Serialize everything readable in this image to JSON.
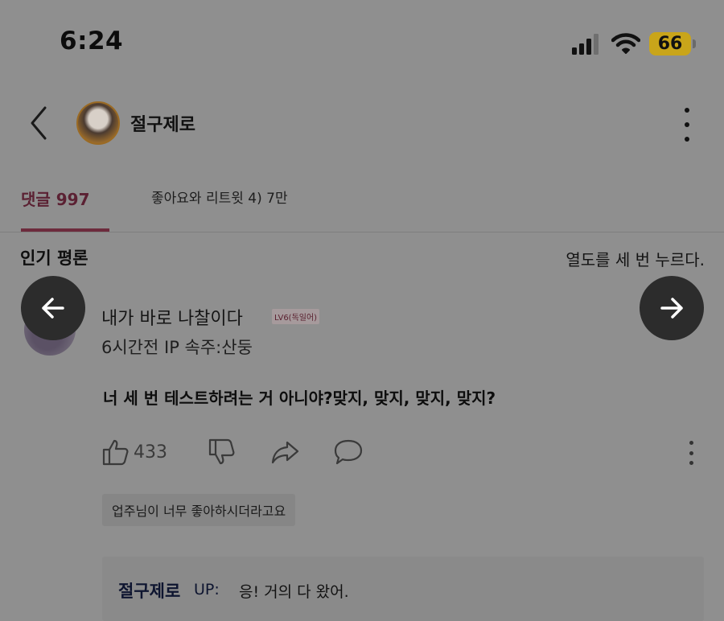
{
  "status_bar": {
    "time": "6:24",
    "battery": "66",
    "icons": [
      "cellular-signal-icon",
      "wifi-icon",
      "battery-icon"
    ],
    "battery_color": "#c9a51a"
  },
  "header": {
    "username": "절구제로",
    "back_icon": "chevron-left-icon",
    "menu_icon": "more-vertical-icon"
  },
  "tabs": [
    {
      "label": "댓글 997",
      "active": true
    },
    {
      "label": "좋아요와 리트윗 4) 7만",
      "active": false
    }
  ],
  "accent_color": "#6d2b3d",
  "section": {
    "title": "인기 평론",
    "sort_label": "열도를 세 번 누르다."
  },
  "comment": {
    "author": "내가 바로 나찰이다",
    "level": "LV6(독일어)",
    "meta": "6시간전 IP 속주:산둥",
    "text": "너 세 번 테스트하려는 거 아니야?맞지, 맞지, 맞지, 맞지?",
    "likes": "433",
    "action_icons": [
      "thumbs-up-icon",
      "thumbs-down-icon",
      "share-icon",
      "comment-icon",
      "more-vertical-icon"
    ],
    "reply_tag": "업주님이 너무 좋아하시더라고요",
    "reply": {
      "author": "절구제로",
      "badge": "UP:",
      "text": "응! 거의 다 왔어."
    }
  },
  "nav": {
    "prev_icon": "arrow-left-icon",
    "next_icon": "arrow-right-icon"
  }
}
